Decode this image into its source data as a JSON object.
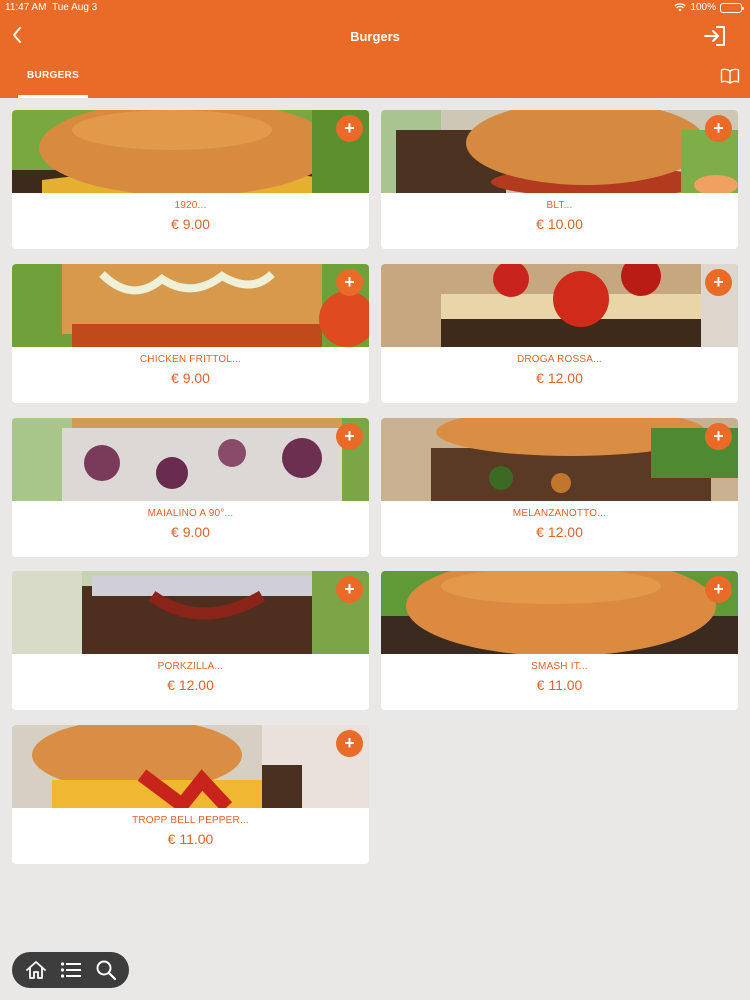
{
  "status_bar": {
    "time": "11:47 AM",
    "date": "Tue Aug 3",
    "battery": "100%"
  },
  "header": {
    "title": "Burgers"
  },
  "tabs": [
    {
      "label": "BURGERS",
      "active": true
    }
  ],
  "colors": {
    "accent": "#ea6a28",
    "background": "#e9e8e6",
    "text_accent": "#e0632a"
  },
  "products": [
    {
      "name": "1920...",
      "price": "€ 9.00"
    },
    {
      "name": "BLT...",
      "price": "€ 10.00"
    },
    {
      "name": "CHICKEN FRITTOL...",
      "price": "€ 9.00"
    },
    {
      "name": "DROGA ROSSA...",
      "price": "€ 12.00"
    },
    {
      "name": "MAIALINO A 90°...",
      "price": "€ 9.00"
    },
    {
      "name": "MELANZANOTTO...",
      "price": "€ 12.00"
    },
    {
      "name": "PORKZILLA...",
      "price": "€ 12.00"
    },
    {
      "name": "SMASH IT...",
      "price": "€ 11.00"
    },
    {
      "name": "TROPP BELL PEPPER...",
      "price": "€ 11.00"
    }
  ],
  "add_label": "+",
  "icons": {
    "back": "chevron-left-icon",
    "login": "login-arrow-icon",
    "menu_book": "book-icon",
    "home": "home-icon",
    "list": "list-icon",
    "search": "search-icon"
  }
}
